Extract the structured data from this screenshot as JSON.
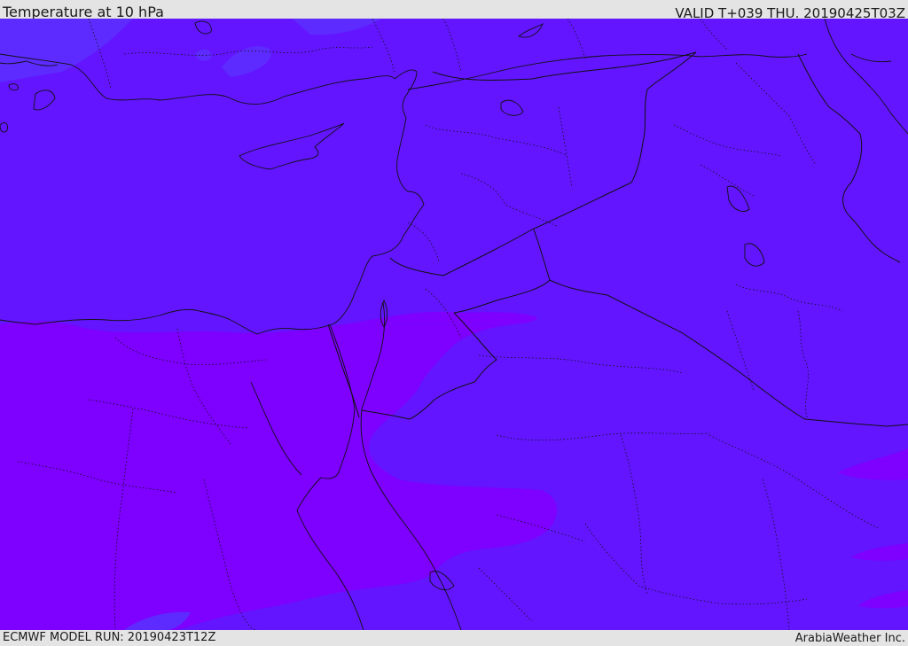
{
  "header": {
    "title": "Temperature at 10 hPa",
    "valid": "VALID T+039 THU. 20190425T03Z"
  },
  "footer": {
    "model_run": "ECMWF MODEL RUN: 20190423T12Z",
    "credit": "ArabiaWeather Inc."
  },
  "map": {
    "colors": {
      "field_main": "#6315ff",
      "field_warm": "#7e00ff",
      "field_light": "#5d2bff",
      "boundary": "#111111"
    },
    "layers": [
      "temperature-field",
      "coastlines",
      "country-borders",
      "province-borders"
    ]
  }
}
